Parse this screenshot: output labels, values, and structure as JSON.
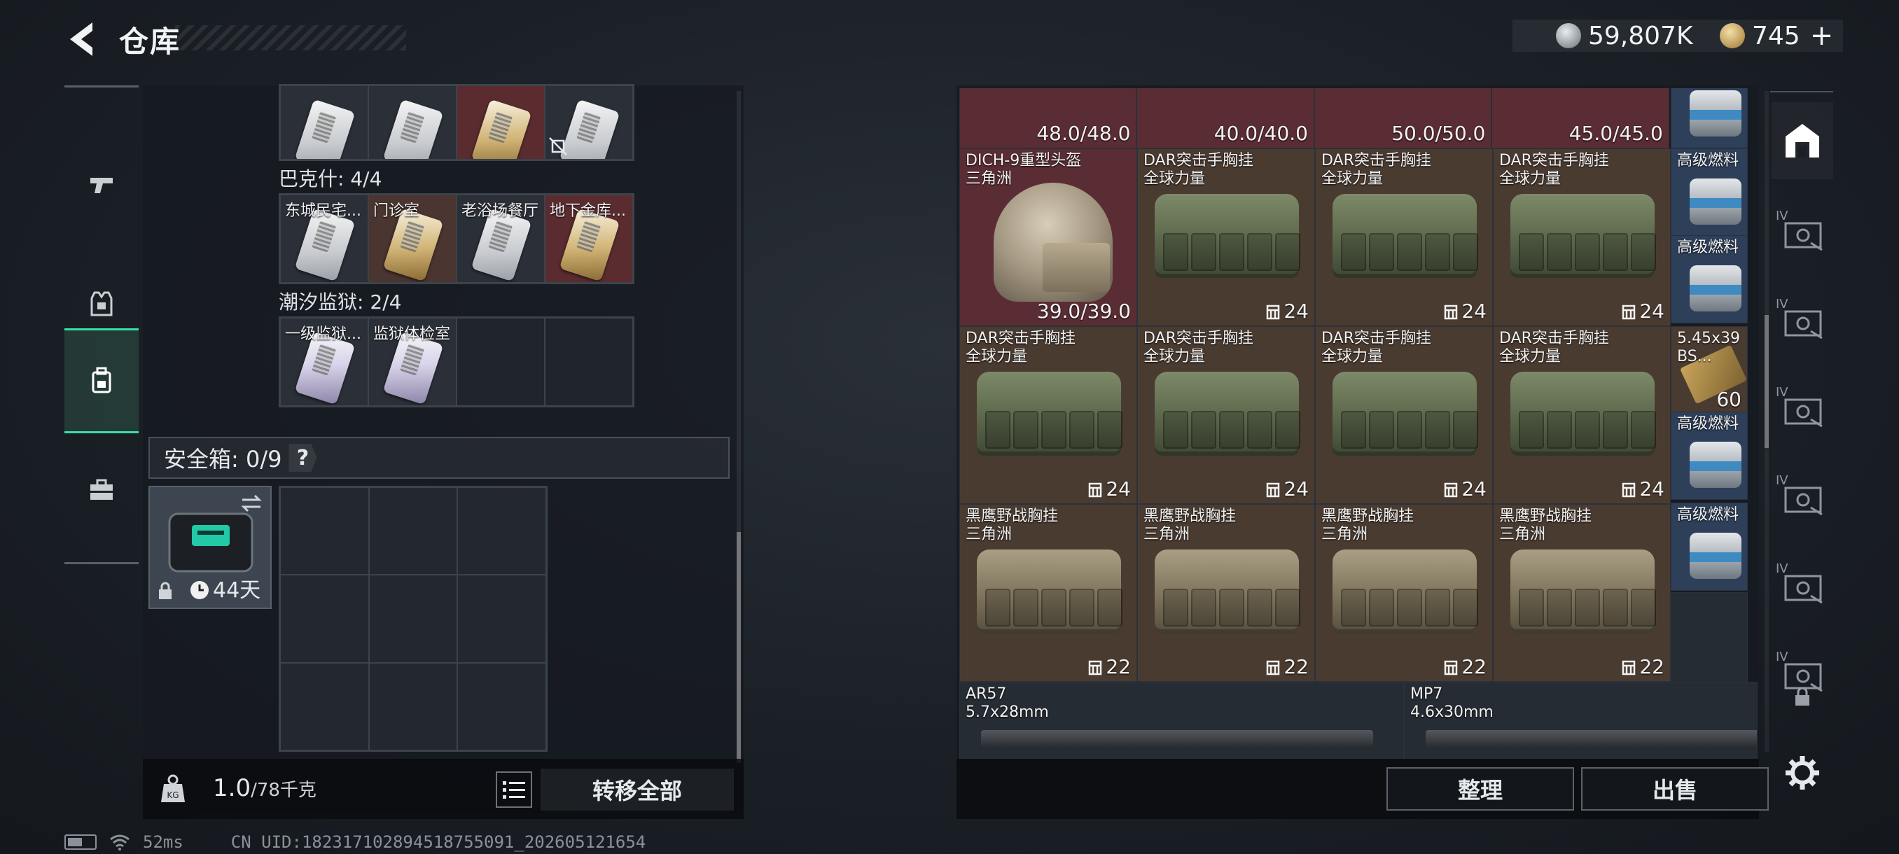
{
  "header": {
    "title": "仓库",
    "currency_silver": "59,807K",
    "currency_gold": "745",
    "plus_label": "+"
  },
  "left": {
    "key_rows_top": [
      [
        {
          "name": "",
          "style": "silver"
        },
        {
          "name": "",
          "style": "silver"
        },
        {
          "name": "",
          "style": "gold-red"
        },
        {
          "name": "",
          "style": "silver",
          "no_drop": true
        }
      ]
    ],
    "bakshi_label": "巴克什: 4/4",
    "bakshi_keys": [
      {
        "name": "东城民宅...",
        "style": "silver"
      },
      {
        "name": "门诊室",
        "style": "gold"
      },
      {
        "name": "老浴场餐厅",
        "style": "silver"
      },
      {
        "name": "地下金库...",
        "style": "gold-red"
      }
    ],
    "prison_label": "潮汐监狱: 2/4",
    "prison_keys": [
      {
        "name": "一级监狱...",
        "style": "purple"
      },
      {
        "name": "监狱体检室",
        "style": "purple"
      },
      {
        "name": "",
        "style": "empty"
      },
      {
        "name": "",
        "style": "empty"
      }
    ],
    "safe_label": "安全箱: 0/9",
    "safe_help": "?",
    "safe_item_time": "44天",
    "weight_value": "1.0",
    "weight_max": "/78千克",
    "transfer_all": "转移全部"
  },
  "right": {
    "row0_values": [
      "48.0/48.0",
      "40.0/40.0",
      "50.0/50.0",
      "45.0/45.0"
    ],
    "row1": [
      {
        "name": "DICH-9重型头盔",
        "sub": "三角洲",
        "kind": "helmet",
        "val": "39.0/39.0"
      },
      {
        "name": "DAR突击手胸挂",
        "sub": "全球力量",
        "kind": "vest",
        "cap": "24"
      },
      {
        "name": "DAR突击手胸挂",
        "sub": "全球力量",
        "kind": "vest",
        "cap": "24"
      },
      {
        "name": "DAR突击手胸挂",
        "sub": "全球力量",
        "kind": "vest",
        "cap": "24"
      }
    ],
    "row2": [
      {
        "name": "DAR突击手胸挂",
        "sub": "全球力量",
        "kind": "vest",
        "cap": "24"
      },
      {
        "name": "DAR突击手胸挂",
        "sub": "全球力量",
        "kind": "vest",
        "cap": "24"
      },
      {
        "name": "DAR突击手胸挂",
        "sub": "全球力量",
        "kind": "vest",
        "cap": "24"
      },
      {
        "name": "DAR突击手胸挂",
        "sub": "全球力量",
        "kind": "vest",
        "cap": "24"
      }
    ],
    "row3": [
      {
        "name": "黑鹰野战胸挂",
        "sub": "三角洲",
        "kind": "vest-tan",
        "cap": "22"
      },
      {
        "name": "黑鹰野战胸挂",
        "sub": "三角洲",
        "kind": "vest-tan",
        "cap": "22"
      },
      {
        "name": "黑鹰野战胸挂",
        "sub": "三角洲",
        "kind": "vest-tan",
        "cap": "22"
      },
      {
        "name": "黑鹰野战胸挂",
        "sub": "三角洲",
        "kind": "vest-tan",
        "cap": "22"
      }
    ],
    "side_col": [
      {
        "name": "",
        "kind": "fuel"
      },
      {
        "name": "高级燃料",
        "kind": "fuel"
      },
      {
        "name": "高级燃料",
        "kind": "fuel"
      },
      {
        "name": "5.45x39",
        "sub": "BS...",
        "kind": "ammo",
        "val": "60"
      },
      {
        "name": "高级燃料",
        "kind": "fuel"
      },
      {
        "name": "高级燃料",
        "kind": "fuel"
      },
      {
        "name": "",
        "kind": "empty"
      }
    ],
    "guns": [
      {
        "name": "AR57",
        "sub": "5.7x28mm"
      },
      {
        "name": "MP7",
        "sub": "4.6x30mm"
      }
    ],
    "organize_label": "整理",
    "sell_label": "出售"
  },
  "status": {
    "ping": "52ms",
    "uid": "CN UID:1823171028945187550​91_202605121654"
  },
  "right_tabs": [
    "IV",
    "IV",
    "IV",
    "IV",
    "IV",
    "IV"
  ]
}
